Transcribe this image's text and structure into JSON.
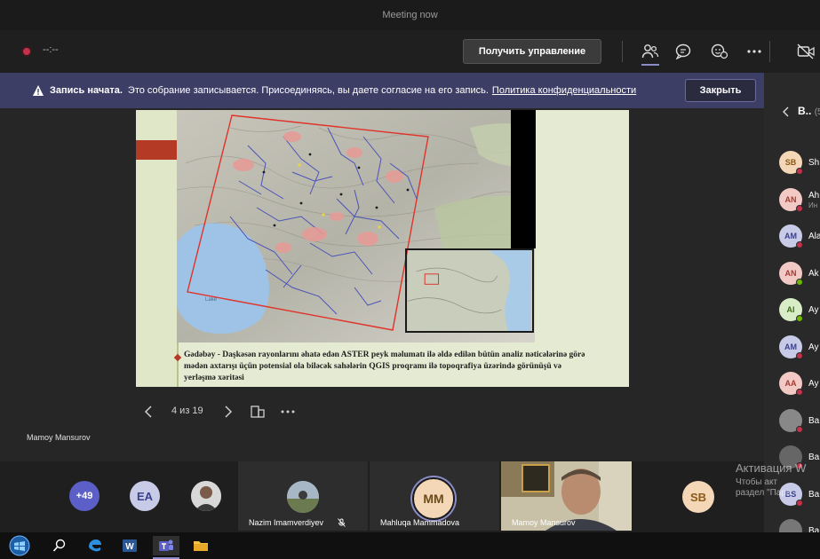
{
  "window": {
    "title": "Meeting now"
  },
  "controls": {
    "timer": "--:--",
    "take_control": "Получить управление"
  },
  "banner": {
    "title": "Запись начата.",
    "text": "Это собрание записывается. Присоединяясь, вы даете согласие на его запись.",
    "link": "Политика конфиденциальности",
    "close": "Закрыть"
  },
  "slide": {
    "caption": "Gədəbəy - Daşkəsən rayonlarını əhatə edən ASTER peyk məlumatı ilə əldə edilən bütün analiz nəticələrinə görə mədən axtarışı üçün potensial ola biləcək sahələrin QGIS proqramı ilə topoqrafiya üzərində görünüşü və yerləşmə xəritəsi",
    "map_label": "Lake"
  },
  "pager": {
    "page": "4 из 19"
  },
  "presenter": {
    "name": "Mamoy Mansurov"
  },
  "strip": {
    "overflow": "+49",
    "ea": "EA",
    "tiles": [
      {
        "name": "Nazim Imamverdiyev"
      },
      {
        "initials": "MM",
        "name": "Mahluqa Mammadova"
      },
      {
        "name": "Mamoy Mansurov"
      },
      {
        "initials": "SB"
      }
    ]
  },
  "panel": {
    "title": "В..",
    "count": "(5",
    "participants": [
      {
        "initials": "SB",
        "name": "Sh",
        "sub": "",
        "color": "#f3d7b6",
        "fg": "#8a5a1a",
        "status": "#c4314b"
      },
      {
        "initials": "AN",
        "name": "Ah",
        "sub": "Ин",
        "color": "#f2c9c5",
        "fg": "#a43b32",
        "status": "#c4314b"
      },
      {
        "initials": "AM",
        "name": "Ala",
        "sub": "",
        "color": "#c8cbe8",
        "fg": "#3a3f8a",
        "status": "#c4314b"
      },
      {
        "initials": "AN",
        "name": "Ak",
        "sub": "",
        "color": "#f2c9c5",
        "fg": "#a43b32",
        "status": "#6bb700"
      },
      {
        "initials": "AI",
        "name": "Ay",
        "sub": "",
        "color": "#d9ecc8",
        "fg": "#3f6b1a",
        "status": "#6bb700"
      },
      {
        "initials": "AM",
        "name": "Ay",
        "sub": "",
        "color": "#c8cbe8",
        "fg": "#3a3f8a",
        "status": "#c4314b"
      },
      {
        "initials": "AA",
        "name": "Ay",
        "sub": "",
        "color": "#f2c9c5",
        "fg": "#a43b32",
        "status": "#c4314b"
      },
      {
        "initials": "",
        "name": "Ba",
        "sub": "",
        "color": "#888888",
        "fg": "#ffffff",
        "status": "#c4314b"
      },
      {
        "initials": "",
        "name": "Ba",
        "sub": "",
        "color": "#666666",
        "fg": "#ffffff",
        "status": "#c4314b"
      },
      {
        "initials": "BS",
        "name": "Ba",
        "sub": "",
        "color": "#c8cbe8",
        "fg": "#3a3f8a",
        "status": "#c4314b"
      },
      {
        "initials": "",
        "name": "Ba",
        "sub": "",
        "color": "#777777",
        "fg": "#ffffff",
        "status": "#c4314b"
      }
    ]
  },
  "watermark": {
    "line1": "Активация W",
    "line2": "Чтобы акт",
    "line3": "раздел \"Пара"
  }
}
